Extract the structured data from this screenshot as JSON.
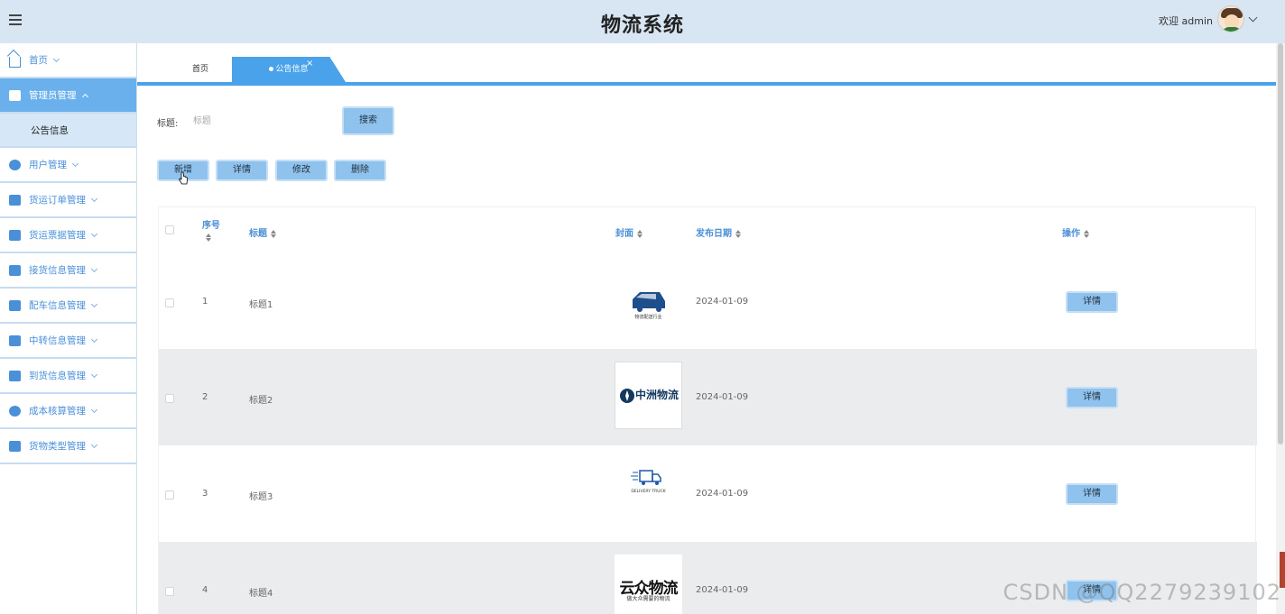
{
  "header": {
    "title": "物流系统",
    "welcome": "欢迎 admin",
    "menu_icon": "hamburger-icon",
    "avatar_icon": "avatar-icon"
  },
  "sidebar": {
    "items": [
      {
        "label": "首页",
        "icon": "home-icon"
      },
      {
        "label": "管理员管理",
        "icon": "envelope-icon",
        "active": true,
        "children": [
          {
            "label": "公告信息"
          }
        ]
      },
      {
        "label": "用户管理",
        "icon": "user-badge-icon"
      },
      {
        "label": "货运订单管理",
        "icon": "order-box-icon"
      },
      {
        "label": "货运票据管理",
        "icon": "document-icon"
      },
      {
        "label": "接货信息管理",
        "icon": "truck-icon"
      },
      {
        "label": "配车信息管理",
        "icon": "vehicle-grid-icon"
      },
      {
        "label": "中转信息管理",
        "icon": "transfer-grid-icon"
      },
      {
        "label": "到货信息管理",
        "icon": "arrival-box-icon"
      },
      {
        "label": "成本核算管理",
        "icon": "calculator-icon"
      },
      {
        "label": "货物类型管理",
        "icon": "briefcase-icon"
      }
    ]
  },
  "tabs": [
    {
      "label": "首页"
    },
    {
      "label": "公告信息",
      "active": true,
      "close": "×"
    }
  ],
  "search": {
    "label": "标题:",
    "placeholder": "标题",
    "button": "搜索"
  },
  "actions": {
    "add": "新增",
    "detail": "详情",
    "edit": "修改",
    "delete": "删除"
  },
  "table": {
    "columns": [
      "序号",
      "标题",
      "封面",
      "发布日期",
      "操作"
    ],
    "rows": [
      {
        "index": "1",
        "title": "标题1",
        "date": "2024-01-09",
        "cover_text": "物流配送行业",
        "action": "详情"
      },
      {
        "index": "2",
        "title": "标题2",
        "date": "2024-01-09",
        "cover_text": "中洲物流",
        "action": "详情"
      },
      {
        "index": "3",
        "title": "标题3",
        "date": "2024-01-09",
        "cover_text": "DELIVERY TRUCK",
        "action": "详情"
      },
      {
        "index": "4",
        "title": "标题4",
        "date": "2024-01-09",
        "cover_text": "云众物流",
        "cover_sub": "做大众需要的物流",
        "action": "详情"
      }
    ]
  },
  "watermark": "CSDN @QQ2279239102",
  "colors": {
    "header_bg": "#d8e6f3",
    "accent": "#4aa3ea",
    "menu_text": "#4a90d9",
    "button_bg": "#8fc2ec",
    "row_alt": "#eaecee"
  }
}
